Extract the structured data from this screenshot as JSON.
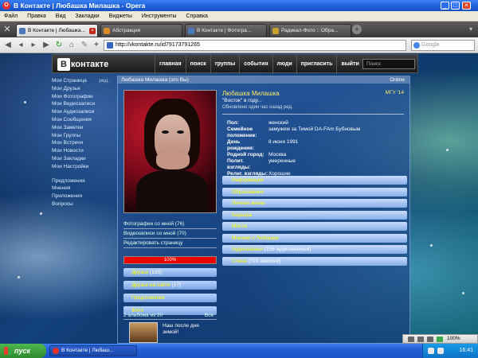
{
  "window": {
    "title": "В Контакте | Любашка Милашка - Opera",
    "minimize": "_",
    "maximize": "□",
    "close": "×"
  },
  "menubar": [
    "Файл",
    "Правка",
    "Вид",
    "Закладки",
    "Виджеты",
    "Инструменты",
    "Справка"
  ],
  "tabs": [
    {
      "label": "В Контакте | Любашка..."
    },
    {
      "label": "Абстракция"
    },
    {
      "label": "В Контакте | Фотогра..."
    },
    {
      "label": "Радикал-Фото :: Обра..."
    }
  ],
  "address": {
    "url": "http://vkontakte.ru/id79173791265",
    "search_placeholder": "Google"
  },
  "vk": {
    "logo": "контакте",
    "logo_letter": "В",
    "nav": [
      "главная",
      "поиск",
      "группы",
      "события",
      "люди",
      "пригласить",
      "выйти"
    ],
    "search_placeholder": "Поиск",
    "menu": [
      "Моя Страница",
      "Мои Друзья",
      "Мои Фотографии",
      "Мои Видеозаписи",
      "Мои Аудиозаписи",
      "Мои Сообщения",
      "Мои Заметки",
      "Мои Группы",
      "Мои Встречи",
      "Мои Новости",
      "Мои Закладки",
      "Мои Настройки"
    ],
    "menu_edit": "ред.",
    "menu2": [
      "Предложения",
      "Мнения",
      "Приложения",
      "Вопросы"
    ]
  },
  "profile": {
    "header_name": "Любашка Милашка (это Вы)",
    "online": "Online",
    "name": "Любашка Милашка",
    "number": "МГУ '14",
    "status": "\"Восток\" в году...",
    "updated": "Обновлено один час назад ред.",
    "info": [
      {
        "label": "Пол:",
        "value": "женский"
      },
      {
        "label": "Семейное положение:",
        "value": "замужем за Тимой DA-FAm Бубновым"
      },
      {
        "label": "День рождения:",
        "value": "8 июня 1991"
      },
      {
        "label": "Родной город:",
        "value": "Москва"
      },
      {
        "label": "Полит. взгляды:",
        "value": "умеренные"
      },
      {
        "label": "Религ. взгляды:",
        "value": "Хорошие"
      }
    ],
    "sections": [
      {
        "label": "Информация",
        "count": ""
      },
      {
        "label": "Образование",
        "count": ""
      },
      {
        "label": "Личная жизнь",
        "count": ""
      },
      {
        "label": "Карьера",
        "count": ""
      },
      {
        "label": "Места",
        "count": ""
      },
      {
        "label": "Мнения о Любашке",
        "count": ""
      },
      {
        "label": "Аудиозаписи",
        "count": "(156 аудиозаписей)"
      },
      {
        "label": "Стена",
        "count": "(719 записей)"
      }
    ],
    "left_links": [
      "Фотографии со мной (76)",
      "Видеозаписи со мной (70)",
      "Редактировать страницу"
    ],
    "progress_label": "100%",
    "progress_value": 1.0,
    "left_sections": [
      {
        "label": "Друзья",
        "count": "(133)"
      },
      {
        "label": "Друзья на сайте",
        "count": "(17)"
      },
      {
        "label": "Предложения",
        "count": ""
      },
      {
        "label": "Фото",
        "count": ""
      }
    ],
    "albums_label": "2 альбома из 20",
    "albums_all": "Все",
    "album_title": "Наш после дня зимой!"
  },
  "opera_status": {
    "zoom": "100%"
  },
  "taskbar": {
    "start": "пуск",
    "item": "В Контакте | Любаш...",
    "clock": "16:41"
  }
}
